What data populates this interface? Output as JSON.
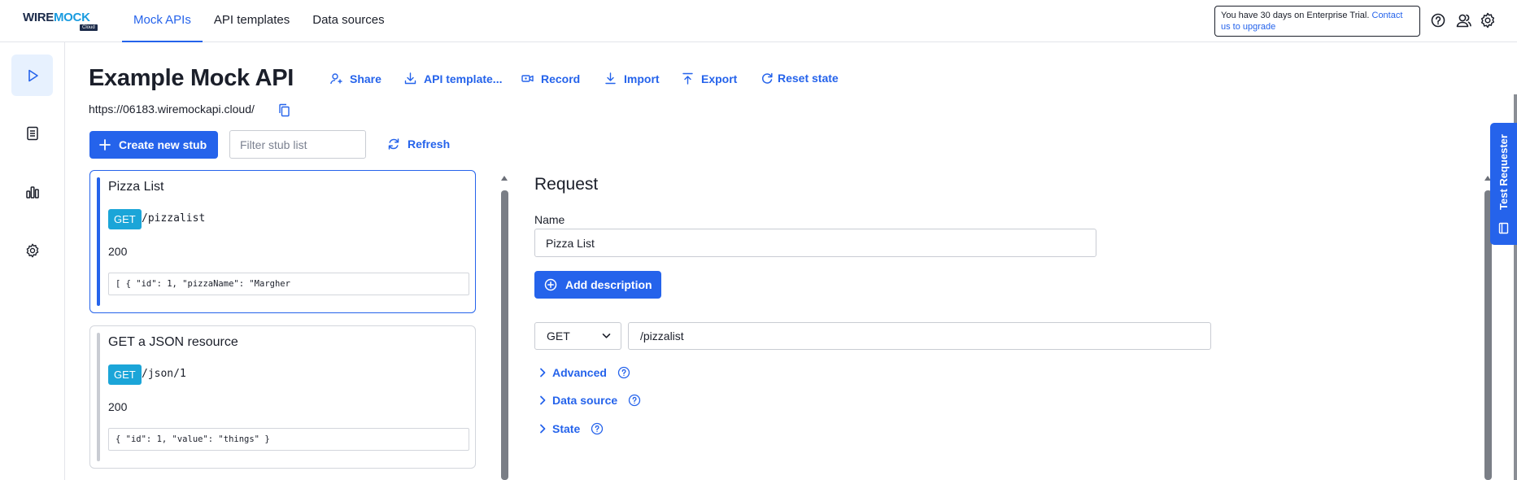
{
  "brand": {
    "logo_main": "WIRE",
    "logo_accent": "MOCK",
    "logo_sub": "Cloud"
  },
  "topnav": {
    "items": [
      {
        "label": "Mock APIs",
        "active": true
      },
      {
        "label": "API templates",
        "active": false
      },
      {
        "label": "Data sources",
        "active": false
      }
    ]
  },
  "trial": {
    "text": "You have 30 days on Enterprise Trial.",
    "link": "Contact us to upgrade"
  },
  "top_icons": [
    "help-icon",
    "users-icon",
    "settings-icon"
  ],
  "rail": [
    "play-icon",
    "document-icon",
    "analytics-icon",
    "settings-icon"
  ],
  "api": {
    "title": "Example Mock API",
    "url": "https://06183.wiremockapi.cloud/",
    "actions": {
      "share": "Share",
      "api_template": "API template...",
      "record": "Record",
      "import": "Import",
      "export": "Export",
      "reset_state": "Reset state"
    }
  },
  "toolbar": {
    "create_stub": "Create new stub",
    "filter_placeholder": "Filter stub list",
    "refresh": "Refresh"
  },
  "stubs": [
    {
      "name": "Pizza List",
      "method": "GET",
      "path": "/pizzalist",
      "status": "200",
      "body": "[ { \"id\": 1, \"pizzaName\": \"Margher",
      "selected": true
    },
    {
      "name": "GET a JSON resource",
      "method": "GET",
      "path": "/json/1",
      "status": "200",
      "body": "{ \"id\": 1, \"value\": \"things\" }",
      "selected": false
    }
  ],
  "request": {
    "title": "Request",
    "name_label": "Name",
    "name_value": "Pizza List",
    "add_description": "Add description",
    "method_value": "GET",
    "url_value": "/pizzalist",
    "sections": {
      "advanced": "Advanced",
      "data_source": "Data source",
      "state": "State"
    }
  },
  "test_requester": {
    "label": "Test Requester"
  },
  "colors": {
    "accent": "#2563eb",
    "method_badge": "#1ba5d8",
    "rail_active": "#e7f1fe"
  }
}
